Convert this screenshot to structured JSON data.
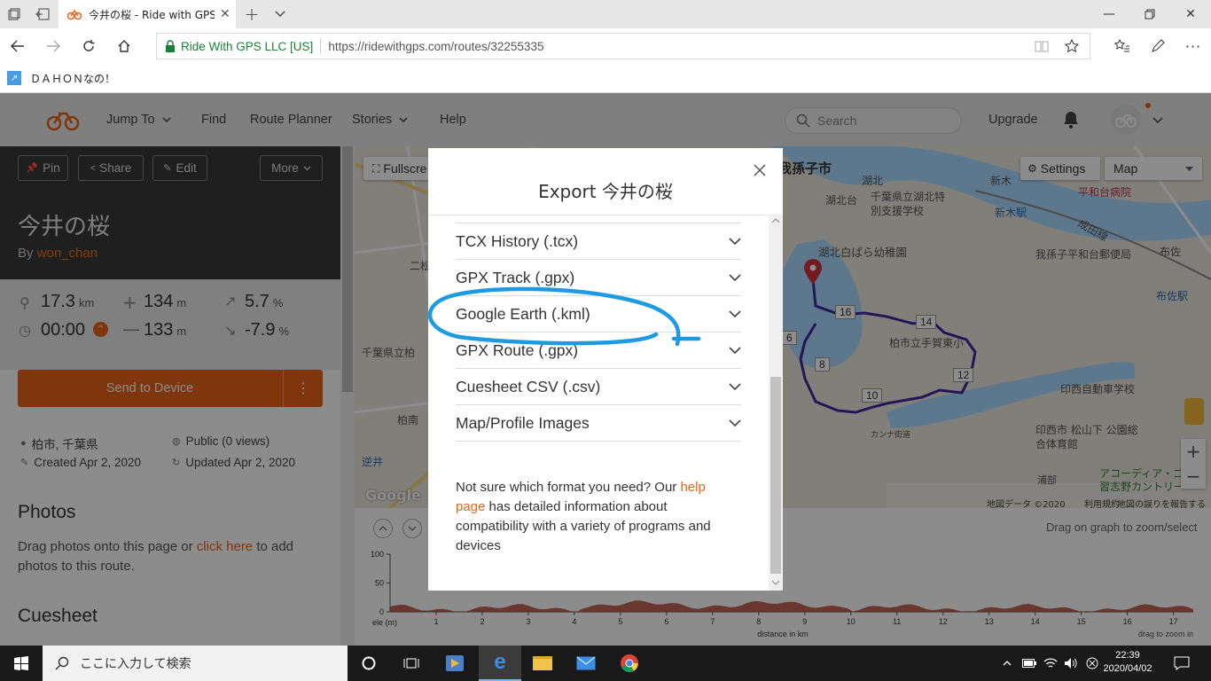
{
  "browser": {
    "tab_title": "今井の桜 - Ride with GPS",
    "cert_org": "Ride With GPS LLC [US]",
    "url": "https://ridewithgps.com/routes/32255335",
    "favorite": "ＤＡＨＯＮなの！"
  },
  "site_nav": {
    "items": [
      "Jump To",
      "Find",
      "Route Planner",
      "Stories",
      "Help"
    ],
    "search_placeholder": "Search",
    "upgrade": "Upgrade"
  },
  "route": {
    "buttons": {
      "pin": "Pin",
      "share": "Share",
      "edit": "Edit",
      "more": "More"
    },
    "title": "今井の桜",
    "by_label": "By",
    "author": "won_chan",
    "stats": {
      "distance": "17.3",
      "distance_unit": "km",
      "elev_gain": "134",
      "elev_gain_unit": "m",
      "grade_up": "5.7",
      "grade_up_unit": "%",
      "time": "00:00",
      "elev_loss": "133",
      "elev_loss_unit": "m",
      "grade_down": "-7.9",
      "grade_down_unit": "%"
    },
    "send_button": "Send to Device",
    "location": "柏市, 千葉県",
    "privacy": "Public (0 views)",
    "created": "Created Apr 2, 2020",
    "updated": "Updated Apr 2, 2020",
    "photos_heading": "Photos",
    "photos_text_before": "Drag photos onto this page or ",
    "photos_link": "click here",
    "photos_text_after": " to add photos to this route.",
    "cuesheet_heading": "Cuesheet"
  },
  "map": {
    "fullscreen": "Fullscre",
    "settings": "Settings",
    "map_type": "Map",
    "labels": [
      "我孫子市",
      "湖北",
      "湖北台",
      "新木",
      "新木駅",
      "湖北白ばら幼稚園",
      "千葉県立湖北特別支援学校",
      "我孫子平和台郵便局",
      "平和台病院",
      "成田線",
      "布佐",
      "布佐駅",
      "柏市立手賀東小",
      "印西自動車学校",
      "印西市 松山下 公園総合体育館",
      "カンナ街道",
      "アコーディア・ゴルフ習志野カントリー",
      "逆井",
      "千葉県立柏",
      "柏南",
      "二松",
      "浦部"
    ],
    "markers": [
      "16",
      "14",
      "6",
      "8",
      "12",
      "10"
    ],
    "attribution": "地図データ ©2020",
    "terms": "利用規約",
    "report": "地図の誤りを報告する",
    "google": "Google"
  },
  "elevation": {
    "hint": "Drag on graph to zoom/select",
    "y_ticks": [
      "100",
      "50",
      "0"
    ],
    "ylabel": "ele (m)",
    "x_ticks": [
      "1",
      "2",
      "3",
      "4",
      "5",
      "6",
      "7",
      "8",
      "9",
      "10",
      "11",
      "12",
      "13",
      "14",
      "15",
      "16",
      "17"
    ],
    "xlabel": "distance in km",
    "zoom_hint": "drag to zoom in"
  },
  "modal": {
    "title": "Export 今井の桜",
    "formats": [
      "TCX History (.tcx)",
      "GPX Track (.gpx)",
      "Google Earth (.kml)",
      "GPX Route (.gpx)",
      "Cuesheet CSV (.csv)",
      "Map/Profile Images"
    ],
    "note_before": "Not sure which format you need? Our ",
    "note_link": "help page",
    "note_after": " has detailed information about compatibility with a variety of programs and devices"
  },
  "taskbar": {
    "search": "ここに入力して検索",
    "time": "22:39",
    "date": "2020/04/02"
  },
  "colors": {
    "accent": "#e86318",
    "route": "#3d2a9e",
    "annotation": "#1e9be0",
    "elevation_fill": "#b5493a"
  }
}
